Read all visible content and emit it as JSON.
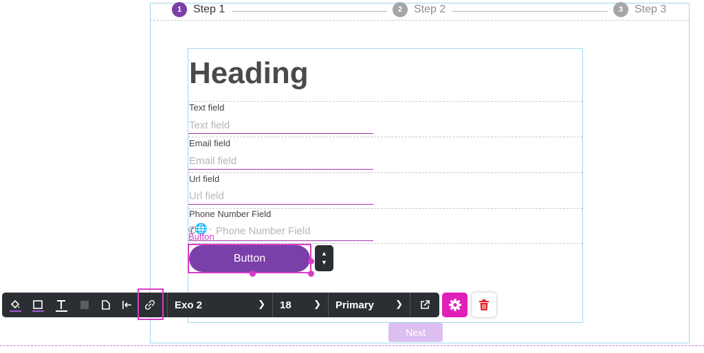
{
  "stepper": {
    "steps": [
      {
        "number": "1",
        "label": "Step 1",
        "state": "active"
      },
      {
        "number": "2",
        "label": "Step 2",
        "state": "inactive"
      },
      {
        "number": "3",
        "label": "Step 3",
        "state": "inactive"
      }
    ]
  },
  "form": {
    "heading": "Heading",
    "fields": {
      "text": {
        "label": "Text field",
        "placeholder": "Text field"
      },
      "email": {
        "label": "Email field",
        "placeholder": "Email field"
      },
      "url": {
        "label": "Url field",
        "placeholder": "Url field"
      },
      "phone": {
        "label": "Phone Number Field",
        "placeholder": "Phone Number Field"
      }
    },
    "button_caption": "Button",
    "button_label": "Button",
    "next_label": "Next"
  },
  "toolbar": {
    "icons": [
      "fill-color-icon",
      "border-color-icon",
      "text-color-icon",
      "background-square-icon",
      "corner-style-icon",
      "align-left-icon",
      "link-icon"
    ],
    "font": "Exo 2",
    "font_size": "18",
    "style": "Primary"
  },
  "colors": {
    "accent_purple": "#7a3fa8",
    "selection_magenta": "#d83bc5",
    "toolbar_dark": "#2b2f33",
    "gear_pink": "#e020b8",
    "trash_red": "#e0242b"
  }
}
